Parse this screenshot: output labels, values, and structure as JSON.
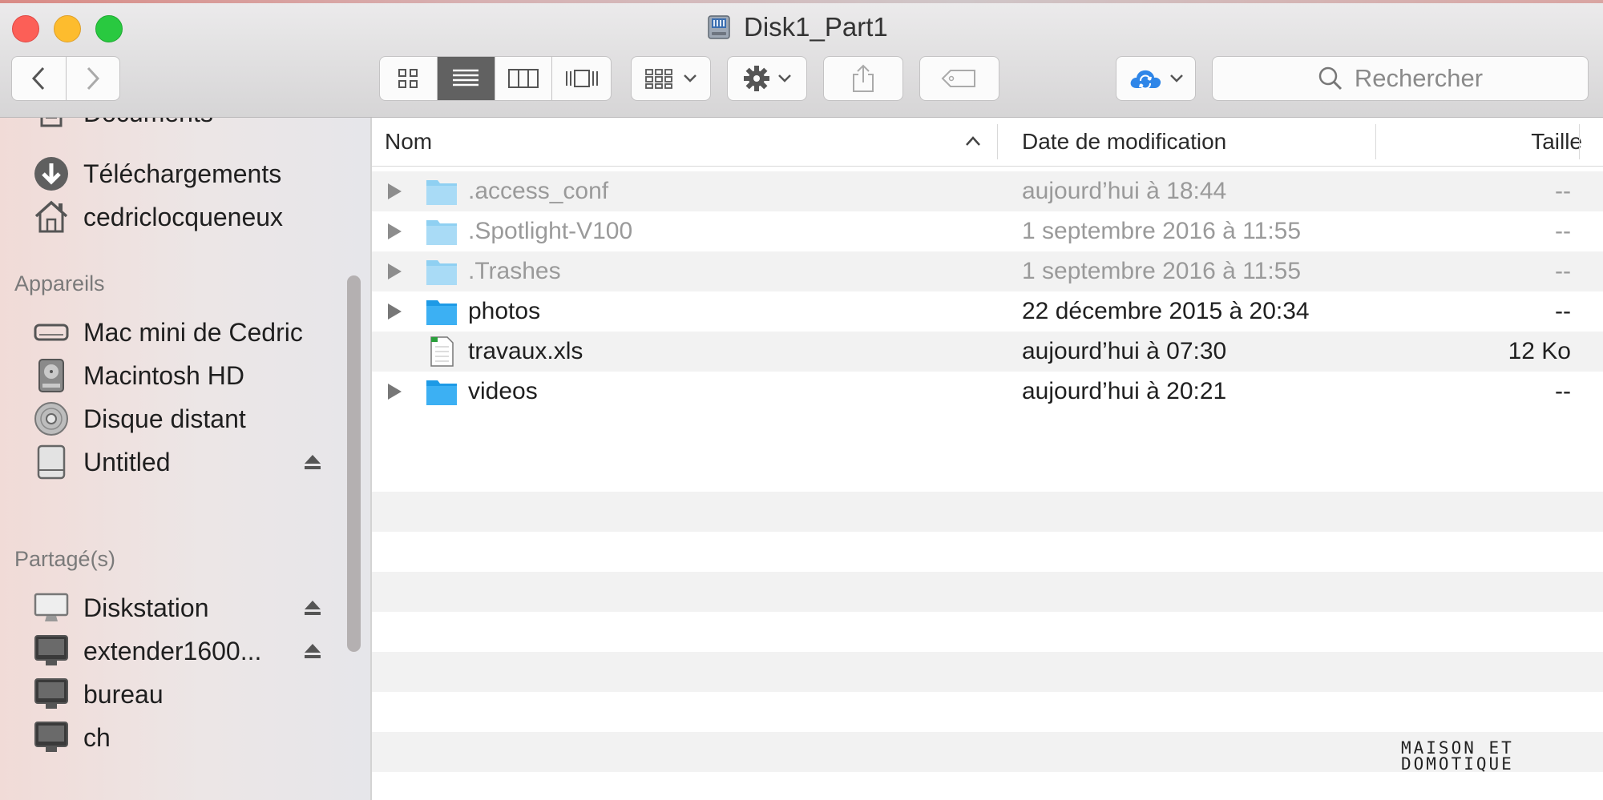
{
  "window": {
    "title": "Disk1_Part1"
  },
  "toolbar": {
    "back_icon": "chevron-left-icon",
    "forward_icon": "chevron-right-icon",
    "view_modes": [
      "icon-view",
      "list-view",
      "column-view",
      "cover-flow-view"
    ],
    "active_view": "list-view",
    "search_placeholder": "Rechercher"
  },
  "sidebar": {
    "favorites": [
      {
        "label": "Documents",
        "icon": "documents-icon"
      },
      {
        "label": "Téléchargements",
        "icon": "downloads-icon"
      },
      {
        "label": "cedriclocqueneux",
        "icon": "home-icon"
      }
    ],
    "devices_header": "Appareils",
    "devices": [
      {
        "label": "Mac mini de Cedric",
        "icon": "mac-mini-icon"
      },
      {
        "label": "Macintosh HD",
        "icon": "hard-drive-icon"
      },
      {
        "label": "Disque distant",
        "icon": "optical-disc-icon"
      },
      {
        "label": "Untitled",
        "icon": "external-drive-icon",
        "eject": true
      }
    ],
    "shared_header": "Partagé(s)",
    "shared": [
      {
        "label": "Diskstation",
        "icon": "display-icon",
        "eject": true
      },
      {
        "label": "extender1600...",
        "icon": "monitor-icon",
        "eject": true
      },
      {
        "label": "bureau",
        "icon": "monitor-icon"
      },
      {
        "label": "ch",
        "icon": "monitor-icon"
      }
    ]
  },
  "columns": {
    "name": "Nom",
    "date": "Date de modification",
    "size": "Taille"
  },
  "files": [
    {
      "name": ".access_conf",
      "date": "aujourd’hui à 18:44",
      "size": "--",
      "type": "folder",
      "hidden": true
    },
    {
      "name": ".Spotlight-V100",
      "date": "1 septembre 2016 à 11:55",
      "size": "--",
      "type": "folder",
      "hidden": true
    },
    {
      "name": ".Trashes",
      "date": "1 septembre 2016 à 11:55",
      "size": "--",
      "type": "folder",
      "hidden": true
    },
    {
      "name": "photos",
      "date": "22 décembre 2015 à 20:34",
      "size": "--",
      "type": "folder",
      "hidden": false
    },
    {
      "name": "travaux.xls",
      "date": "aujourd’hui à 07:30",
      "size": "12 Ko",
      "type": "file",
      "hidden": false
    },
    {
      "name": "videos",
      "date": "aujourd’hui à 20:21",
      "size": "--",
      "type": "folder",
      "hidden": false
    }
  ],
  "watermark": {
    "line1": "MAISON ET",
    "line2": "DOMOTIQUE"
  }
}
